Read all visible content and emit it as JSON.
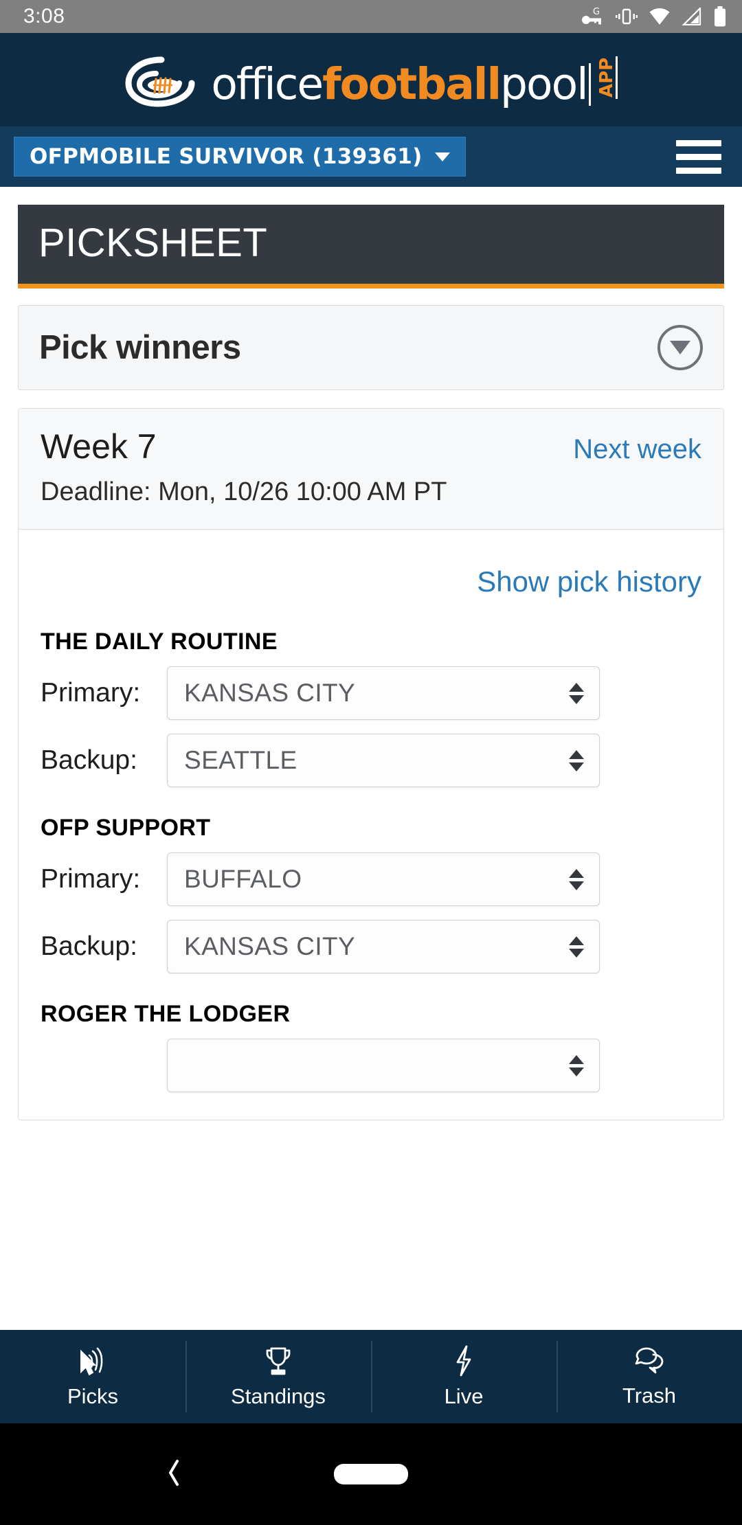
{
  "status_bar": {
    "time": "3:08",
    "icons": [
      "vpn-key-google-icon",
      "vibrate-icon",
      "wifi-icon",
      "cell-signal-icon",
      "battery-icon"
    ]
  },
  "brand": {
    "part_office": "office",
    "part_football": "football",
    "part_pool": "pool",
    "part_app": "APP",
    "logo_icon": "football-eye-logo-icon",
    "colors": {
      "navy": "#0d2b42",
      "orange": "#f18a21",
      "white": "#ffffff"
    }
  },
  "pool_bar": {
    "pool_name": "OFPMOBILE SURVIVOR (139361)",
    "dropdown_icon": "chevron-down-icon",
    "menu_icon": "hamburger-menu-icon"
  },
  "page": {
    "title": "PICKSHEET",
    "accent_color": "#f0941e"
  },
  "pick_winners_panel": {
    "title": "Pick winners",
    "toggle_icon": "chevron-down-circle-icon"
  },
  "week_card": {
    "week_title": "Week 7",
    "next_week_link": "Next week",
    "deadline": "Deadline: Mon, 10/26 10:00 AM PT",
    "show_pick_history_link": "Show pick history",
    "entries": [
      {
        "name": "THE DAILY ROUTINE",
        "picks": [
          {
            "label": "Primary:",
            "value": "KANSAS CITY"
          },
          {
            "label": "Backup:",
            "value": "SEATTLE"
          }
        ]
      },
      {
        "name": "OFP SUPPORT",
        "picks": [
          {
            "label": "Primary:",
            "value": "BUFFALO"
          },
          {
            "label": "Backup:",
            "value": "KANSAS CITY"
          }
        ]
      },
      {
        "name": "ROGER THE LODGER",
        "picks": []
      }
    ]
  },
  "bottom_tabs": [
    {
      "label": "Picks",
      "icon": "fingerprint-pointer-icon"
    },
    {
      "label": "Standings",
      "icon": "trophy-icon"
    },
    {
      "label": "Live",
      "icon": "lightning-bolt-icon"
    },
    {
      "label": "Trash",
      "icon": "chat-bubbles-icon"
    }
  ],
  "android_nav": {
    "back_icon": "back-chevron-icon",
    "home_icon": "home-pill-icon"
  }
}
